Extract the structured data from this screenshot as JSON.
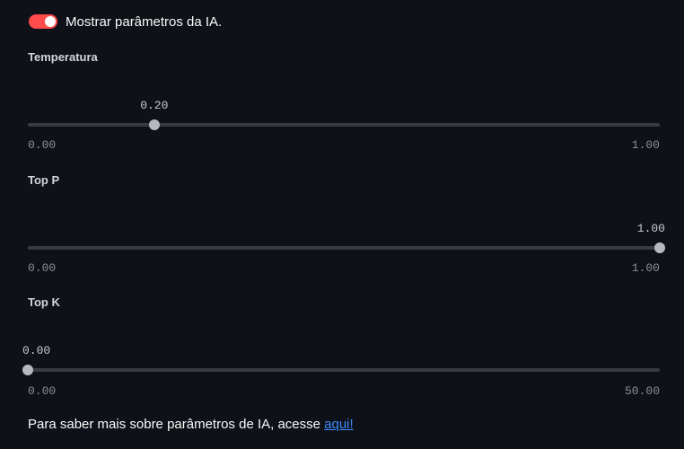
{
  "toggle": {
    "label": "Mostrar parâmetros da IA.",
    "checked": true,
    "color": "#ff4b4b"
  },
  "sliders": [
    {
      "label": "Temperatura",
      "value": 0.2,
      "value_text": "0.20",
      "min": 0,
      "max": 1,
      "min_text": "0.00",
      "max_text": "1.00"
    },
    {
      "label": "Top P",
      "value": 1.0,
      "value_text": "1.00",
      "min": 0,
      "max": 1,
      "min_text": "0.00",
      "max_text": "1.00"
    },
    {
      "label": "Top K",
      "value": 0.0,
      "value_text": "0.00",
      "min": 0,
      "max": 50,
      "min_text": "0.00",
      "max_text": "50.00"
    }
  ],
  "footer": {
    "text": "Para saber mais sobre parâmetros de IA, acesse ",
    "link_text": "aqui!"
  }
}
